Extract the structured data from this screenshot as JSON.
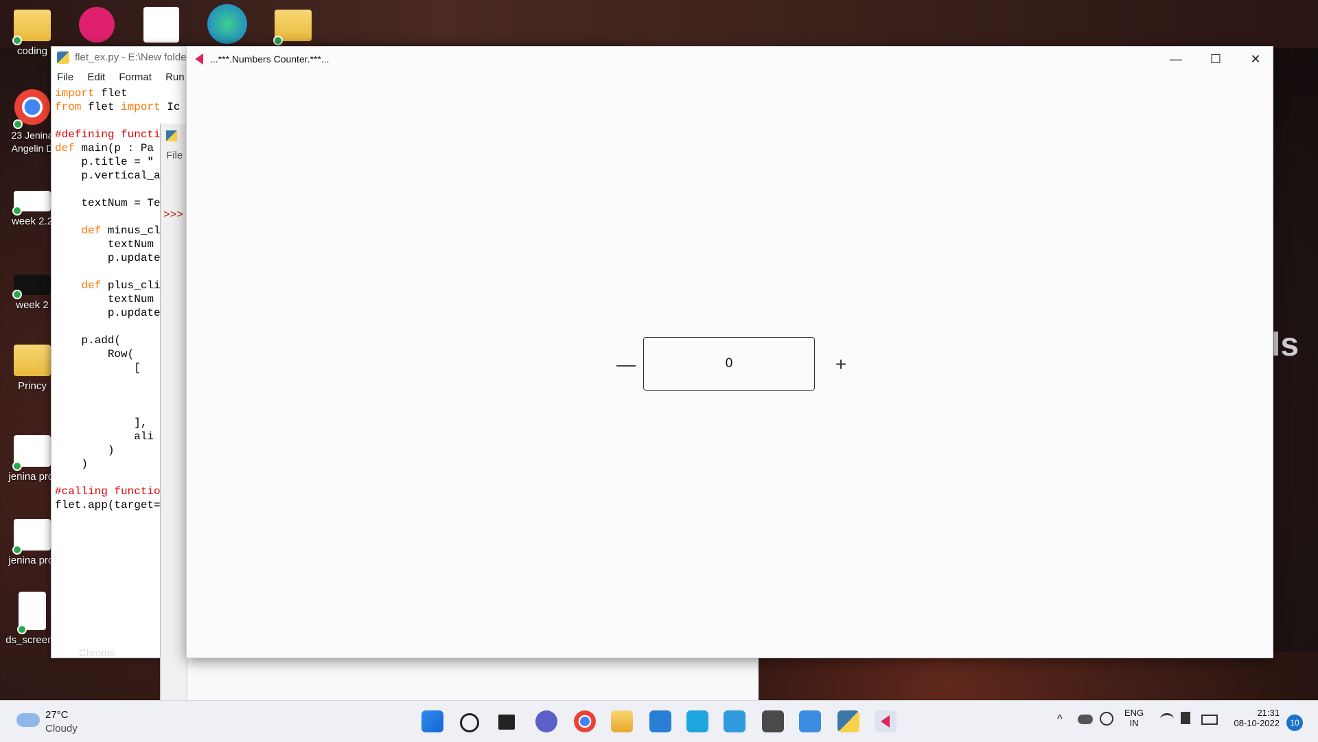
{
  "desktop": {
    "icons": [
      {
        "label": "coding"
      },
      {
        "label": "23 Jenina Angelin D"
      },
      {
        "label": "week 2.2"
      },
      {
        "label": "week 2"
      },
      {
        "label": "Princy"
      },
      {
        "label": "jenina proj"
      },
      {
        "label": "jenina proj"
      },
      {
        "label": "ds_screen_"
      }
    ],
    "background_partial_text": "ls",
    "chrome_label_fragment": "Chrome"
  },
  "idle_editor": {
    "title": "flet_ex.py - E:\\New folde",
    "menu": [
      "File",
      "Edit",
      "Format",
      "Run"
    ],
    "code_lines": [
      "import flet",
      "from flet import Ic",
      "",
      "#defining functi",
      "def main(p : Pa",
      "    p.title = \"",
      "    p.vertical_a",
      "",
      "    textNum = Te",
      "",
      "    def minus_cl",
      "        textNum",
      "        p.update",
      "",
      "    def plus_cli",
      "        textNum",
      "        p.update",
      "",
      "    p.add(",
      "        Row(",
      "            [",
      "",
      "",
      "",
      "            ],",
      "            ali",
      "        )",
      "    )",
      "",
      "#calling functio",
      "flet.app(target="
    ]
  },
  "idle_shell": {
    "menu_label": "File",
    "prompt": ">>>"
  },
  "app": {
    "title": "...***.Numbers Counter.***...",
    "minimize_symbol": "—",
    "maximize_symbol": "☐",
    "close_symbol": "✕",
    "minus_symbol": "—",
    "plus_symbol": "+",
    "counter_value": "0"
  },
  "taskbar": {
    "weather_temp": "27°C",
    "weather_desc": "Cloudy",
    "lang_line1": "ENG",
    "lang_line2": "IN",
    "time": "21:31",
    "date": "08-10-2022",
    "notification_count": "10",
    "pinned": [
      "start-icon",
      "search-icon",
      "task-view-icon",
      "chat-icon",
      "chrome-icon",
      "file-explorer-icon",
      "mail-icon",
      "l-app-icon",
      "vscode-icon",
      "sublime-icon",
      "notepad-icon",
      "idle-icon",
      "flet-icon"
    ]
  }
}
